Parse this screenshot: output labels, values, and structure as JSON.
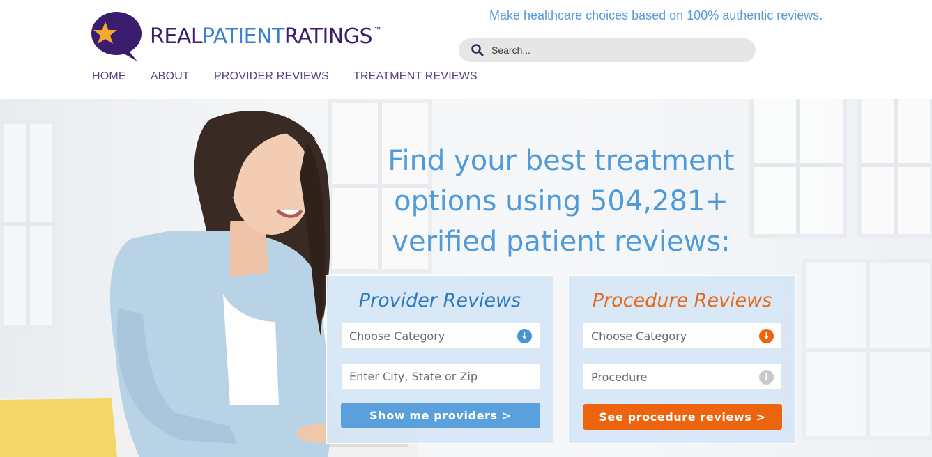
{
  "brand": {
    "name_part1": "REAL",
    "name_part2": "PATIENT",
    "name_part3": "RATINGS",
    "trademark": "™",
    "tagline": "Make healthcare choices based on 100% authentic reviews.",
    "colors": {
      "purple": "#3b1d6e",
      "blue": "#3d7fd0",
      "orange": "#ec650e",
      "star": "#f3a932"
    }
  },
  "search": {
    "placeholder": "Search...",
    "icon": "search-icon"
  },
  "nav": {
    "items": [
      {
        "label": "HOME"
      },
      {
        "label": "ABOUT"
      },
      {
        "label": "PROVIDER REVIEWS"
      },
      {
        "label": "TREATMENT REVIEWS"
      }
    ]
  },
  "hero": {
    "headline_line1": "Find your best treatment",
    "headline_line2": "options using 504,281+",
    "headline_line3": "verified patient reviews:"
  },
  "provider_card": {
    "title": "Provider Reviews",
    "category_value": "Choose Category",
    "location_placeholder": "Enter City, State or Zip",
    "button_label": "Show me providers >"
  },
  "procedure_card": {
    "title": "Procedure Reviews",
    "category_value": "Choose Category",
    "procedure_value": "Procedure",
    "button_label": "See procedure reviews >"
  }
}
